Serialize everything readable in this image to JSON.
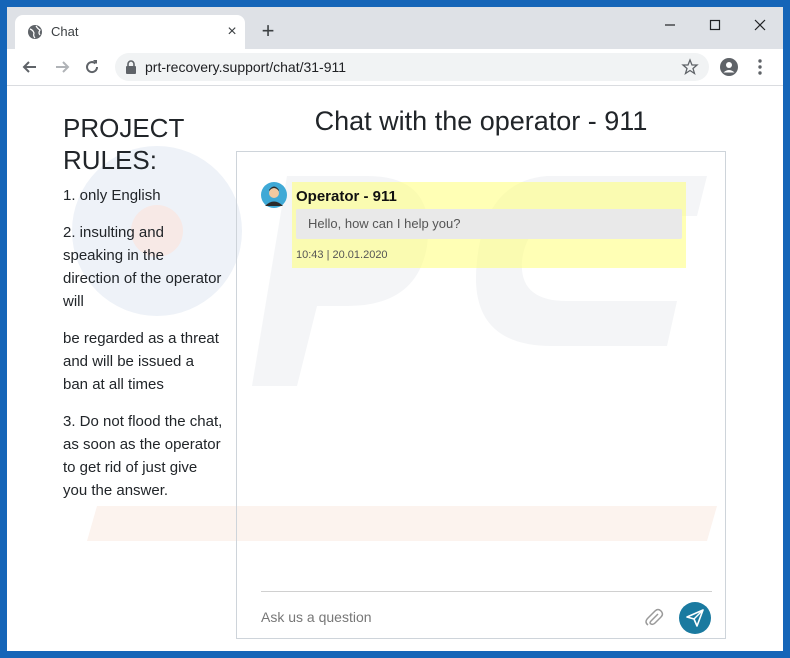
{
  "browser": {
    "tab_title": "Chat",
    "tab_close": "×",
    "new_tab": "+",
    "url": "prt-recovery.support/chat/31-911"
  },
  "rules": {
    "heading": "PROJECT RULES:",
    "items": [
      "1. only English",
      "2. insulting and speaking in the direction of the operator will",
      "be regarded as a threat and will be issued a ban at all times",
      "3. Do not flood the chat, as soon as the operator to get rid of just give you the answer."
    ]
  },
  "chat": {
    "title": "Chat with the operator - 911",
    "messages": [
      {
        "sender": "Operator - 911",
        "text": "Hello, how can I help you?",
        "timestamp": "10:43 | 20.01.2020"
      }
    ],
    "input_placeholder": "Ask us a question"
  },
  "colors": {
    "frame": "#1565b8",
    "send_button": "#1a7aa0",
    "message_highlight": "#ffff78"
  },
  "icons": [
    "globe-icon",
    "close-icon",
    "plus-icon",
    "minimize-icon",
    "maximize-icon",
    "window-close-icon",
    "back-arrow-icon",
    "forward-arrow-icon",
    "reload-icon",
    "lock-icon",
    "star-icon",
    "account-icon",
    "menu-dots-icon",
    "operator-avatar",
    "paperclip-icon",
    "send-icon"
  ]
}
